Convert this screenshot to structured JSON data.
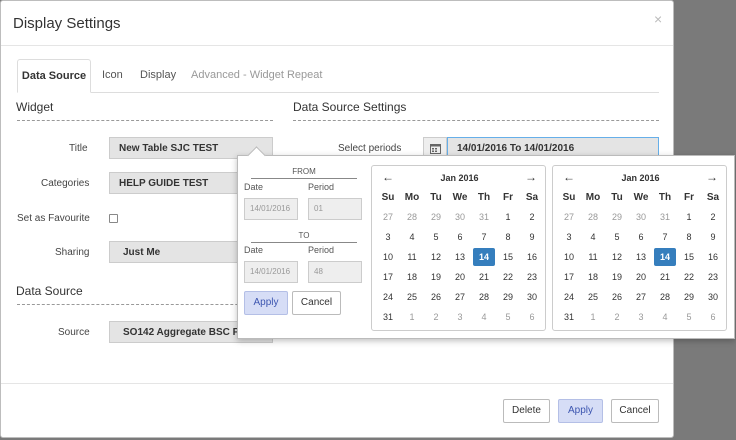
{
  "dialog": {
    "title": "Display Settings",
    "close": "×"
  },
  "tabs": [
    {
      "label": "Data Source",
      "active": true
    },
    {
      "label": "Icon"
    },
    {
      "label": "Display"
    },
    {
      "label": "Advanced - Widget Repeat",
      "disabled": true
    }
  ],
  "widget": {
    "heading": "Widget",
    "title_label": "Title",
    "title_value": "New Table SJC TEST",
    "categories_label": "Categories",
    "categories_value": "HELP GUIDE TEST",
    "favourite_label": "Set as Favourite",
    "sharing_label": "Sharing",
    "sharing_value": "Just Me"
  },
  "data_source": {
    "heading": "Data Source",
    "source_label": "Source",
    "source_value": "SO142 Aggregate BSC Pa"
  },
  "settings": {
    "heading": "Data Source Settings",
    "periods_label": "Select periods",
    "periods_value": "14/01/2016 To 14/01/2016"
  },
  "picker": {
    "from_label": "FROM",
    "to_label": "TO",
    "date_label": "Date",
    "period_label": "Period",
    "from_date": "14/01/2016",
    "from_period": "01",
    "to_date": "14/01/2016",
    "to_period": "48",
    "apply": "Apply",
    "cancel": "Cancel",
    "calendars": [
      {
        "month": "Jan 2016",
        "prev": "←",
        "next": "→"
      },
      {
        "month": "Jan 2016",
        "prev": "←",
        "next": "→"
      }
    ],
    "weekdays": [
      "Su",
      "Mo",
      "Tu",
      "We",
      "Th",
      "Fr",
      "Sa"
    ],
    "days": [
      [
        "27",
        "28",
        "29",
        "30",
        "31",
        "1",
        "2"
      ],
      [
        "3",
        "4",
        "5",
        "6",
        "7",
        "8",
        "9"
      ],
      [
        "10",
        "11",
        "12",
        "13",
        "14",
        "15",
        "16"
      ],
      [
        "17",
        "18",
        "19",
        "20",
        "21",
        "22",
        "23"
      ],
      [
        "24",
        "25",
        "26",
        "27",
        "28",
        "29",
        "30"
      ],
      [
        "31",
        "1",
        "2",
        "3",
        "4",
        "5",
        "6"
      ]
    ],
    "selected_day": "14"
  },
  "footer": {
    "delete": "Delete",
    "apply": "Apply",
    "cancel": "Cancel"
  },
  "colors": {
    "accent": "#357ebd",
    "primary_btn": "#d6ddf6"
  },
  "icons": {
    "calendar": "calendar-icon"
  }
}
